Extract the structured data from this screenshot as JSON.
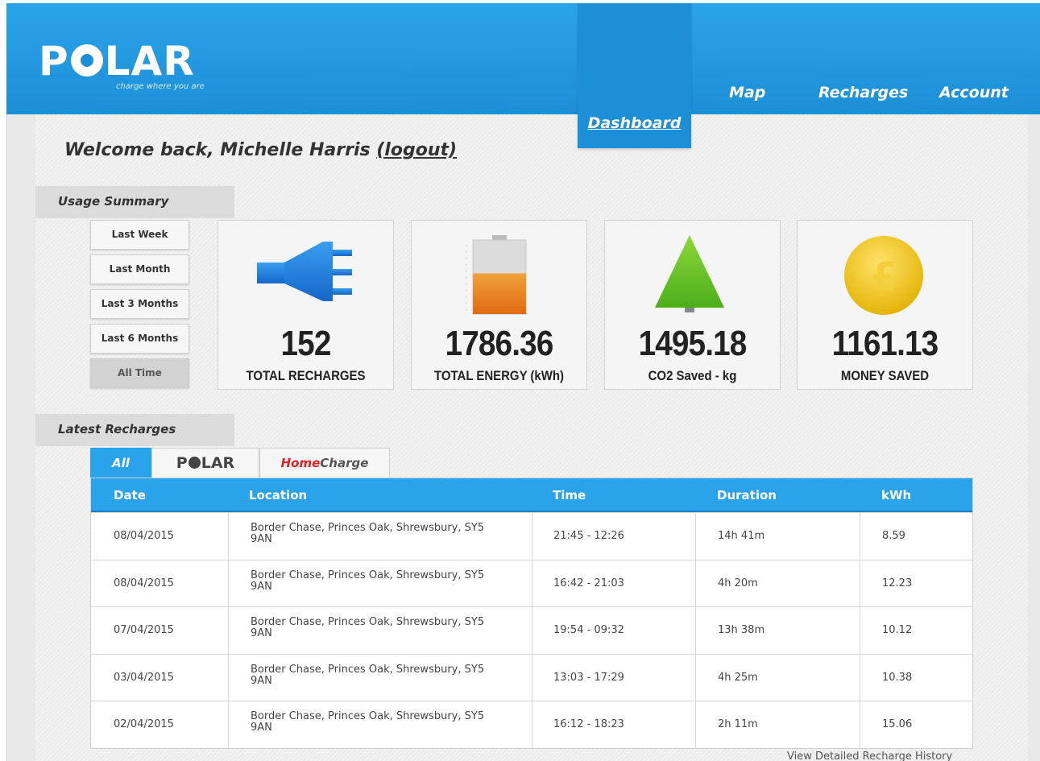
{
  "brand": {
    "logo_text_left": "P",
    "logo_text_right": "LAR",
    "tagline": "charge where you are",
    "accent": "#2aa3ea"
  },
  "nav": {
    "dashboard": "Dashboard",
    "map": "Map",
    "recharges": "Recharges",
    "account": "Account"
  },
  "welcome": {
    "text": "Welcome back, Michelle Harris",
    "logout": "(logout)"
  },
  "usage_summary": {
    "title": "Usage Summary",
    "periods": [
      "Last Week",
      "Last Month",
      "Last 3 Months",
      "Last 6 Months",
      "All Time"
    ],
    "selected": "All Time",
    "stats": [
      {
        "value": "152",
        "label": "TOTAL RECHARGES",
        "icon": "plug-icon"
      },
      {
        "value": "1786.36",
        "label": "TOTAL ENERGY (kWh)",
        "icon": "battery-icon"
      },
      {
        "value": "1495.18",
        "label": "CO2 Saved - kg",
        "icon": "tree-icon"
      },
      {
        "value": "1161.13",
        "label": "MONEY SAVED",
        "icon": "pound-coin-icon"
      }
    ],
    "battery_level": 0.55
  },
  "latest_recharges": {
    "title": "Latest Recharges",
    "tabs": {
      "all": "All",
      "polar_left": "P",
      "polar_right": "LAR",
      "home_part": "Home",
      "charge_part": "Charge"
    },
    "columns": [
      "Date",
      "Location",
      "Time",
      "Duration",
      "kWh"
    ],
    "rows": [
      {
        "date": "08/04/2015",
        "location_1": "Border Chase, Princes Oak, Shrewsbury, SY5",
        "location_2": "9AN",
        "time": "21:45 - 12:26",
        "duration": "14h 41m",
        "kwh": "8.59"
      },
      {
        "date": "08/04/2015",
        "location_1": "Border Chase, Princes Oak, Shrewsbury, SY5",
        "location_2": "9AN",
        "time": "16:42 - 21:03",
        "duration": "4h 20m",
        "kwh": "12.23"
      },
      {
        "date": "07/04/2015",
        "location_1": "Border Chase, Princes Oak, Shrewsbury, SY5",
        "location_2": "9AN",
        "time": "19:54 - 09:32",
        "duration": "13h 38m",
        "kwh": "10.12"
      },
      {
        "date": "03/04/2015",
        "location_1": "Border Chase, Princes Oak, Shrewsbury, SY5",
        "location_2": "9AN",
        "time": "13:03 - 17:29",
        "duration": "4h 25m",
        "kwh": "10.38"
      },
      {
        "date": "02/04/2015",
        "location_1": "Border Chase, Princes Oak, Shrewsbury, SY5",
        "location_2": "9AN",
        "time": "16:12 - 18:23",
        "duration": "2h 11m",
        "kwh": "15.06"
      }
    ],
    "history_link": "View Detailed Recharge History"
  }
}
